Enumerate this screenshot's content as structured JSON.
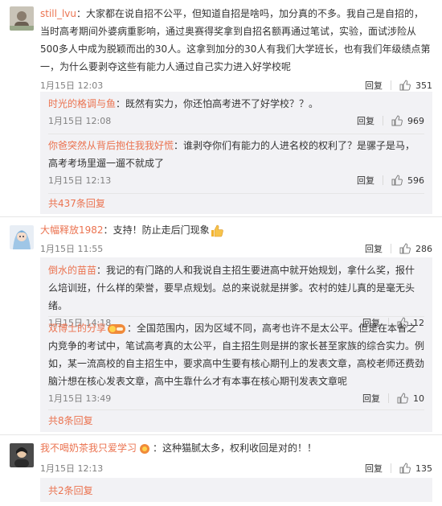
{
  "actions": {
    "reply": "回复"
  },
  "comments": [
    {
      "user": "still_lvu",
      "text": "大家都在说自招不公平，但知道自招是啥吗，加分真的不多。我自己是自招的，当时高考期间外婆病重影响，通过奥赛得奖拿到自招名额再通过笔试，实验，面试涉险从500多人中成为脱颖而出的30人。这拿到加分的30人有我们大学班长，也有我们年级绩点第一，为什么要剥夺这些有能力人通过自己实力进入好学校呢",
      "time": "1月15日 12:03",
      "likes": "351",
      "replies": [
        {
          "user": "时光的格调与鱼",
          "text": "既然有实力，你还怕高考进不了好学校？？。",
          "time": "1月15日 12:08",
          "likes": "969"
        },
        {
          "user": "你爸突然从背后抱住我我好慌",
          "text": "谁剥夺你们有能力的人进名校的权利了？是骡子是马，高考考场里遛一遛不就成了",
          "time": "1月15日 12:13",
          "likes": "596"
        }
      ],
      "more": "共437条回复"
    },
    {
      "user": "大幅释放1982",
      "text": "支持！防止走后门现象",
      "time": "1月15日 11:55",
      "likes": "286",
      "replies": [
        {
          "user": "倒水的苗苗",
          "text": "我记的有门路的人和我说自主招生要进高中就开始规划，拿什么奖，报什么培训班，什么样的荣誉，要早点规划。总的来说就是拼爹。农村的娃儿真的是毫无头绪。",
          "time": "1月15日 14:18",
          "likes": "12"
        },
        {
          "user": "双博士的分享",
          "text": "全国范围内，因为区域不同，高考也许不是太公平。但是在本省之内竞争的考试中，笔试高考真的太公平，自主招生则是拼的家长甚至家族的综合实力。例如，某一流高校的自主招生中，要求高中生要有核心期刊上的发表文章，高校老师还费劲脑汁想在核心发表文章，高中生靠什么才有本事在核心期刊发表文章呢",
          "time": "1月15日 13:49",
          "likes": "10"
        }
      ],
      "more": "共8条回复"
    },
    {
      "user": "我不喝奶茶我只爱学习",
      "text": "这种猫腻太多，权利收回是对的！！",
      "time": "1月15日 12:13",
      "likes": "135",
      "replies": [],
      "more": "共2条回复"
    }
  ],
  "colors": {
    "username": "#eb7350",
    "reply_bg": "#f2f2f5",
    "meta": "#808080"
  },
  "icons": {
    "like": "thumbs-up-icon",
    "emoji": "thumbs-up-emoji",
    "badge": "fan-badge-icon"
  }
}
